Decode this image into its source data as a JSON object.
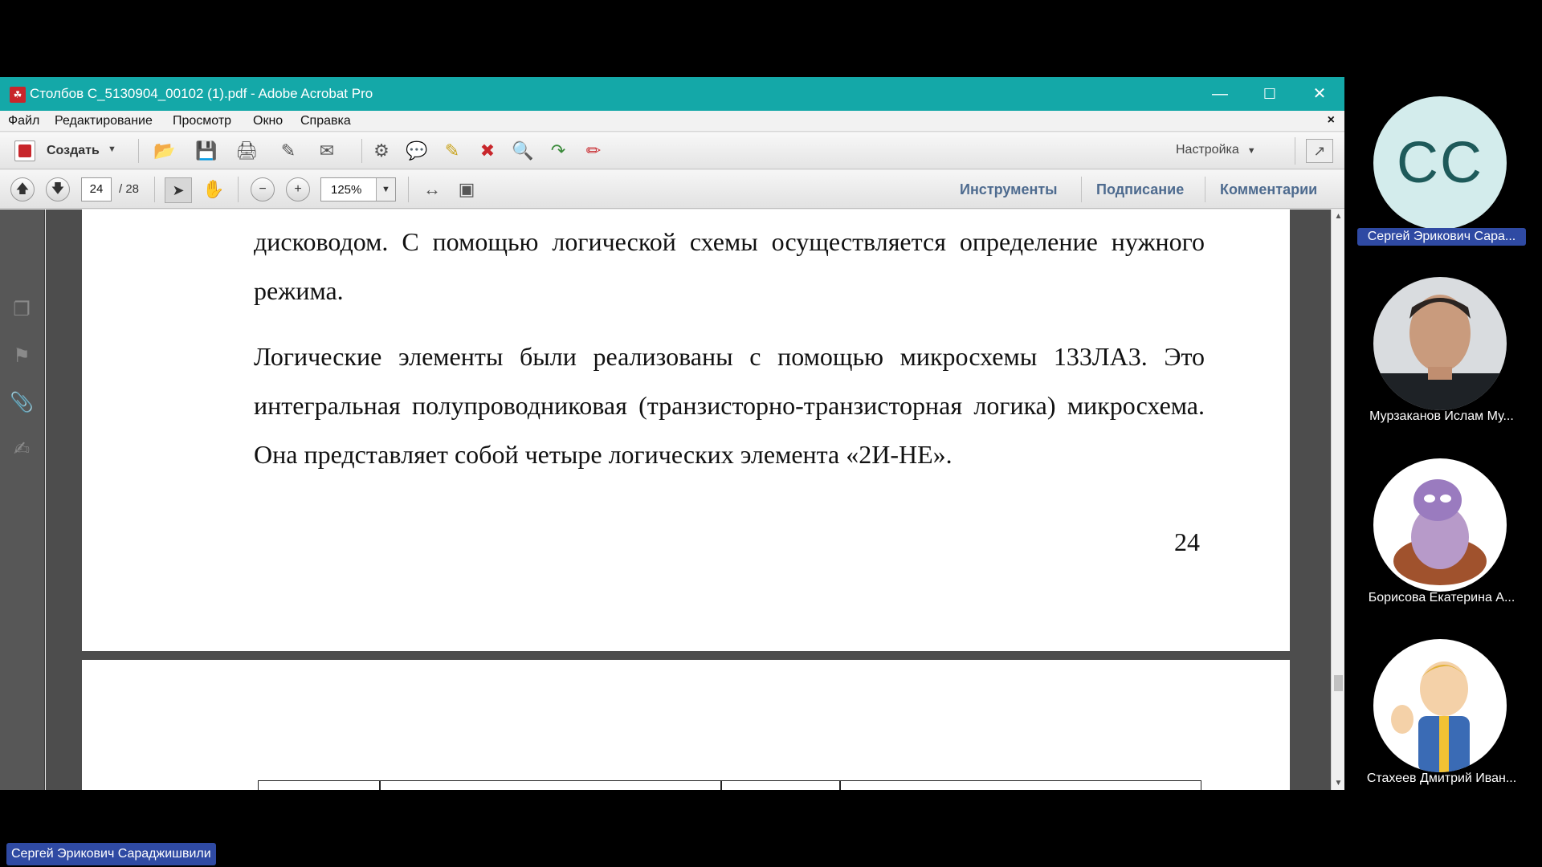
{
  "window": {
    "title": "Столбов С_5130904_00102 (1).pdf - Adobe Acrobat Pro",
    "minimize_icon": "—",
    "maximize_icon": "☐",
    "close_icon": "✕"
  },
  "menu": {
    "items": [
      "Файл",
      "Редактирование",
      "Просмотр",
      "Окно",
      "Справка"
    ],
    "close": "×"
  },
  "toolbar": {
    "create_label": "Создать",
    "settings_label": "Настройка"
  },
  "navigation": {
    "current_page": "24",
    "total_pages": "/ 28",
    "zoom": "125%"
  },
  "panes": {
    "tools": "Инструменты",
    "sign": "Подписание",
    "comments": "Комментарии"
  },
  "document": {
    "paragraph1": "дисководом. С помощью логической схемы осуществляется определение нужного режима.",
    "paragraph2": "Логические элементы были реализованы с помощью микросхемы 133ЛА3. Это интегральная полупроводниковая (транзисторно-транзисторная логика) микросхема. Она представляет собой четыре логических элемента «2И-НЕ».",
    "page_number": "24"
  },
  "participants": [
    {
      "initials": "СС",
      "name": "Сергей Эрикович Сара..."
    },
    {
      "name": "Мурзаканов Ислам Му..."
    },
    {
      "name": "Борисова Екатерина А..."
    },
    {
      "name": "Стахеев Дмитрий Иван..."
    }
  ],
  "active_speaker": "Сергей Эрикович Сараджишвили",
  "colors": {
    "titlebar": "#14a8a8",
    "pane_tab": "#4e6b8f",
    "name_highlight": "#2f4aa3"
  }
}
